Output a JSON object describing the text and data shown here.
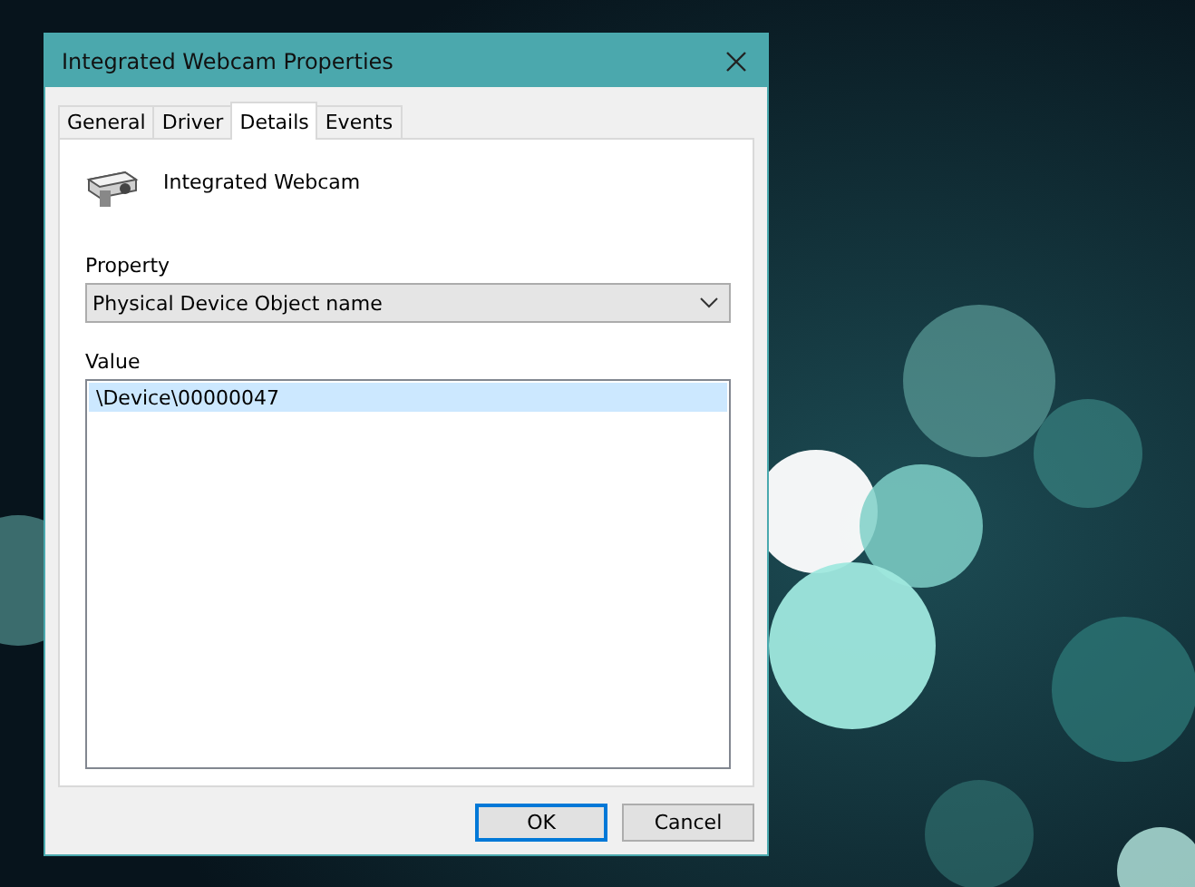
{
  "window": {
    "title": "Integrated Webcam Properties"
  },
  "tabs": [
    {
      "label": "General",
      "selected": false
    },
    {
      "label": "Driver",
      "selected": false
    },
    {
      "label": "Details",
      "selected": true
    },
    {
      "label": "Events",
      "selected": false
    }
  ],
  "device_name": "Integrated Webcam",
  "property": {
    "label": "Property",
    "value": "Physical Device Object name"
  },
  "value": {
    "label": "Value",
    "rows": [
      {
        "text": "\\Device\\00000047",
        "selected": true
      }
    ]
  },
  "buttons": [
    {
      "label": "OK",
      "default": true
    },
    {
      "label": "Cancel",
      "default": false
    }
  ]
}
